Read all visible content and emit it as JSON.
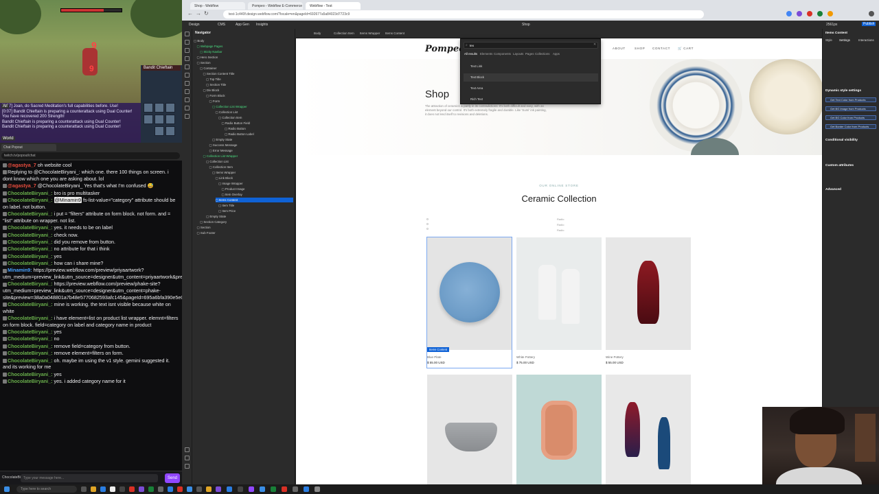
{
  "game": {
    "hud_number_top": "9",
    "hud_number_mid": "9",
    "target_name": "Bandit Chieftain",
    "chat_lines": [
      "[0:07] Joan, do Sacred Meditation's full capabilities before. Use!",
      "[0:07] Bandit Chieftain is preparing a counterattack using Dual Counter!",
      "You have recovered 200 Strength!",
      "Bandit Chieftain is preparing a counterattack using Dual Counter!",
      "Bandit Chieftain is preparing a counterattack using Dual Counter!"
    ],
    "chat_tabs": [
      "All",
      "World"
    ]
  },
  "side_browser": {
    "tab_label": "Chat Popout",
    "url": "twitch.tv/popout/chat"
  },
  "twitch_chat": {
    "messages": [
      {
        "user": "",
        "text": "oh website cool",
        "prefix_user": "@agastya_7",
        "color": "red"
      },
      {
        "user": "",
        "text": "Replying to @ChocolateBiryani_: which one. there 100 things on screen. i dont know which one you are asking about. lol",
        "color": "none"
      },
      {
        "user": "@agastya_7",
        "text": "@ChocolateBiryani_ Yes that's what I'm confused 😅",
        "color": "red"
      },
      {
        "user": "ChocolateBiryani_:",
        "text": "bro is pro multitasker",
        "color": "green"
      },
      {
        "user": "ChocolateBiryani_:",
        "mention": "@Minamin9",
        "text": " fs-list-value=\"category\" attribute should be on label. not button.",
        "color": "green"
      },
      {
        "user": "ChocolateBiryani_:",
        "text": "i put = \"filters\" attribute on form block. not form. and = \"list\" attribute on wrapper. not list.",
        "color": "green"
      },
      {
        "user": "ChocolateBiryani_:",
        "text": "yes. it needs to be on label",
        "color": "green"
      },
      {
        "user": "ChocolateBiryani_:",
        "text": "check now.",
        "color": "green"
      },
      {
        "user": "ChocolateBiryani_:",
        "text": "did you remove from button.",
        "color": "green"
      },
      {
        "user": "ChocolateBiryani_:",
        "text": "no attribute for that i think",
        "color": "green"
      },
      {
        "user": "ChocolateBiryani_:",
        "text": "yes",
        "color": "green"
      },
      {
        "user": "ChocolateBiryani_:",
        "text": "how can i share mine?",
        "color": "green"
      },
      {
        "user": "Minamin9:",
        "text": "https://preview.webflow.com/preview/priyaartwork?utm_medium=preview_link&utm_source=designer&utm_content=priyaartwork&preview=3247ba99e257f9bf992e3d1303bdd051&pageId=694299e568be4cbb7534b134&locale=en&workflow=preview",
        "color": "blue"
      },
      {
        "user": "ChocolateBiryani_:",
        "text": "https://preview.webflow.com/preview/phake-site?utm_medium=preview_link&utm_source=designer&utm_content=phake-site&preview=38a0a048801a7b48e5770682593afc145&pageId=695a6bfa390e5e0c94cbcad2&locale=en&workflow=preview",
        "color": "green"
      },
      {
        "user": "ChocolateBiryani_:",
        "text": "mine is working. the text isnt visible because white on white",
        "color": "green"
      },
      {
        "user": "ChocolateBiryani_:",
        "text": "i have element=list on product list wrapper. elemnt=filters on form block. field=category on label and category name in product",
        "color": "green"
      },
      {
        "user": "ChocolateBiryani_:",
        "text": "yes",
        "color": "green"
      },
      {
        "user": "ChocolateBiryani_:",
        "text": "no",
        "color": "green"
      },
      {
        "user": "ChocolateBiryani_:",
        "text": "remove field=category from button.",
        "color": "green"
      },
      {
        "user": "ChocolateBiryani_:",
        "text": "remove element=filters on form.",
        "color": "green"
      },
      {
        "user": "ChocolateBiryani_:",
        "text": "oh. maybe im using the v1 style. gemini suggested it. and its working for me",
        "color": "green"
      },
      {
        "user": "ChocolateBiryani_:",
        "text": "yes",
        "color": "green"
      },
      {
        "user": "ChocolateBiryani_:",
        "text": "yes. i added category name for it",
        "color": "green"
      }
    ],
    "input_sender": "ChocolateBiryani_",
    "input_placeholder": "Type your message here...",
    "send_label": "Send"
  },
  "chrome": {
    "tabs": [
      "Shop - Webflow",
      "Pompeo - Webflow E-Commerce",
      "Webflow - Test"
    ],
    "url": "test-1c440f.design.webflow.com/?locale=en&pageId=692677a5a84023d7723c9"
  },
  "designer": {
    "top_items": [
      "Design",
      "CMS",
      "App Gen",
      "Insights"
    ],
    "breakpoint": "2561px",
    "mode": "Shop",
    "publish_label": "Publish",
    "breadcrumbs": [
      "Body",
      "Collection Item",
      "Items Wrapper",
      "Items Content"
    ],
    "navigator_title": "Navigator",
    "tree": [
      {
        "label": "Body",
        "indent": 0
      },
      {
        "label": "Webpage Pages",
        "indent": 1,
        "comp": true
      },
      {
        "label": "Sticky Navbar",
        "indent": 2,
        "comp": true
      },
      {
        "label": "Hero Section",
        "indent": 1
      },
      {
        "label": "Section",
        "indent": 1
      },
      {
        "label": "Container",
        "indent": 2
      },
      {
        "label": "Section Content Title",
        "indent": 3
      },
      {
        "label": "Top Title",
        "indent": 4
      },
      {
        "label": "Section Title",
        "indent": 4
      },
      {
        "label": "Div Block",
        "indent": 3
      },
      {
        "label": "Form Block",
        "indent": 4
      },
      {
        "label": "Form",
        "indent": 5
      },
      {
        "label": "Collection List Wrapper",
        "indent": 6,
        "comp": true
      },
      {
        "label": "Collection List",
        "indent": 7
      },
      {
        "label": "Collection Item",
        "indent": 8
      },
      {
        "label": "Radio Button Field",
        "indent": 9
      },
      {
        "label": "Radio Button",
        "indent": 10
      },
      {
        "label": "Radio Button Label",
        "indent": 10
      },
      {
        "label": "Empty State",
        "indent": 6
      },
      {
        "label": "Success Message",
        "indent": 5
      },
      {
        "label": "Error Message",
        "indent": 5
      },
      {
        "label": "Collection List Wrapper",
        "indent": 3,
        "comp": true
      },
      {
        "label": "Collection List",
        "indent": 4
      },
      {
        "label": "Collection Item",
        "indent": 5
      },
      {
        "label": "Items Wrapper",
        "indent": 6
      },
      {
        "label": "Link Block",
        "indent": 7
      },
      {
        "label": "Image Wrapper",
        "indent": 8
      },
      {
        "label": "Product Image",
        "indent": 9
      },
      {
        "label": "Item Overlay",
        "indent": 9
      },
      {
        "label": "Items Content",
        "indent": 7,
        "selected": true
      },
      {
        "label": "Item Title",
        "indent": 8
      },
      {
        "label": "Item Price",
        "indent": 8
      },
      {
        "label": "Empty State",
        "indent": 4
      },
      {
        "label": "Section Category",
        "indent": 2
      },
      {
        "label": "Section",
        "indent": 1
      },
      {
        "label": "Sub Footer",
        "indent": 1
      }
    ],
    "right_panel": {
      "element_name": "Items Content",
      "tabs": [
        "Style",
        "Settings",
        "Interactions"
      ],
      "dynamic_heading": "Dynamic style settings",
      "bindings": [
        "Get Text Color from Products",
        "Get BG Image from Products",
        "Get BG Color from Products",
        "Get Border Color from Products"
      ],
      "conditional_heading": "Conditional visibility",
      "custom_attr_heading": "Custom attributes",
      "advanced_heading": "Advanced"
    },
    "add_panel": {
      "query": "tex",
      "categories": [
        "All results",
        "Elements",
        "Components",
        "Layouts",
        "Pages",
        "Collections",
        "Apps"
      ],
      "results": [
        "Text Link",
        "Text Block",
        "Text Area",
        "Rich Text"
      ]
    }
  },
  "site": {
    "logo": "Pompeo",
    "nav_links": [
      "ABOUT",
      "SHOP",
      "CONTACT"
    ],
    "cart_label": "CART",
    "hero_title": "Shop",
    "hero_text": "The attraction of ceramics is partly in its contradictions: It's both difficult and easy, with an element beyond our control. It's both extremely fragile and durable. Like 'Sumi' ink painting, it does not lend itself to revisions and deletions.",
    "eyebrow": "OUR ONLINE STORE",
    "collection_title": "Ceramic Collection",
    "filters": [
      "Radio",
      "Radio",
      "Radio"
    ],
    "component_badge": "Items Content",
    "products": [
      {
        "name": "Blue Plate",
        "price": "$ 55.00 USD",
        "bg": "#e4e4e4",
        "shape": "plate",
        "color": "#6d9cc7"
      },
      {
        "name": "White Pottery",
        "price": "$ 75.00 USD",
        "bg": "#e9ecec",
        "shape": "bottles",
        "color": "#f3f3f3"
      },
      {
        "name": "Wine Pottery",
        "price": "$ 55.00 USD",
        "bg": "#e7e7e7",
        "shape": "vase",
        "color": "#8e1a22"
      },
      {
        "name": "",
        "price": "",
        "bg": "#e6e6e6",
        "shape": "bowl",
        "color": "#8a8d90"
      },
      {
        "name": "",
        "price": "",
        "bg": "#bfd9d6",
        "shape": "dish",
        "color": "#d98c6b"
      },
      {
        "name": "",
        "price": "",
        "bg": "#e8e8e8",
        "shape": "vases2",
        "color": "#8e1a2a"
      }
    ]
  },
  "taskbar": {
    "search_placeholder": "Type here to search"
  }
}
